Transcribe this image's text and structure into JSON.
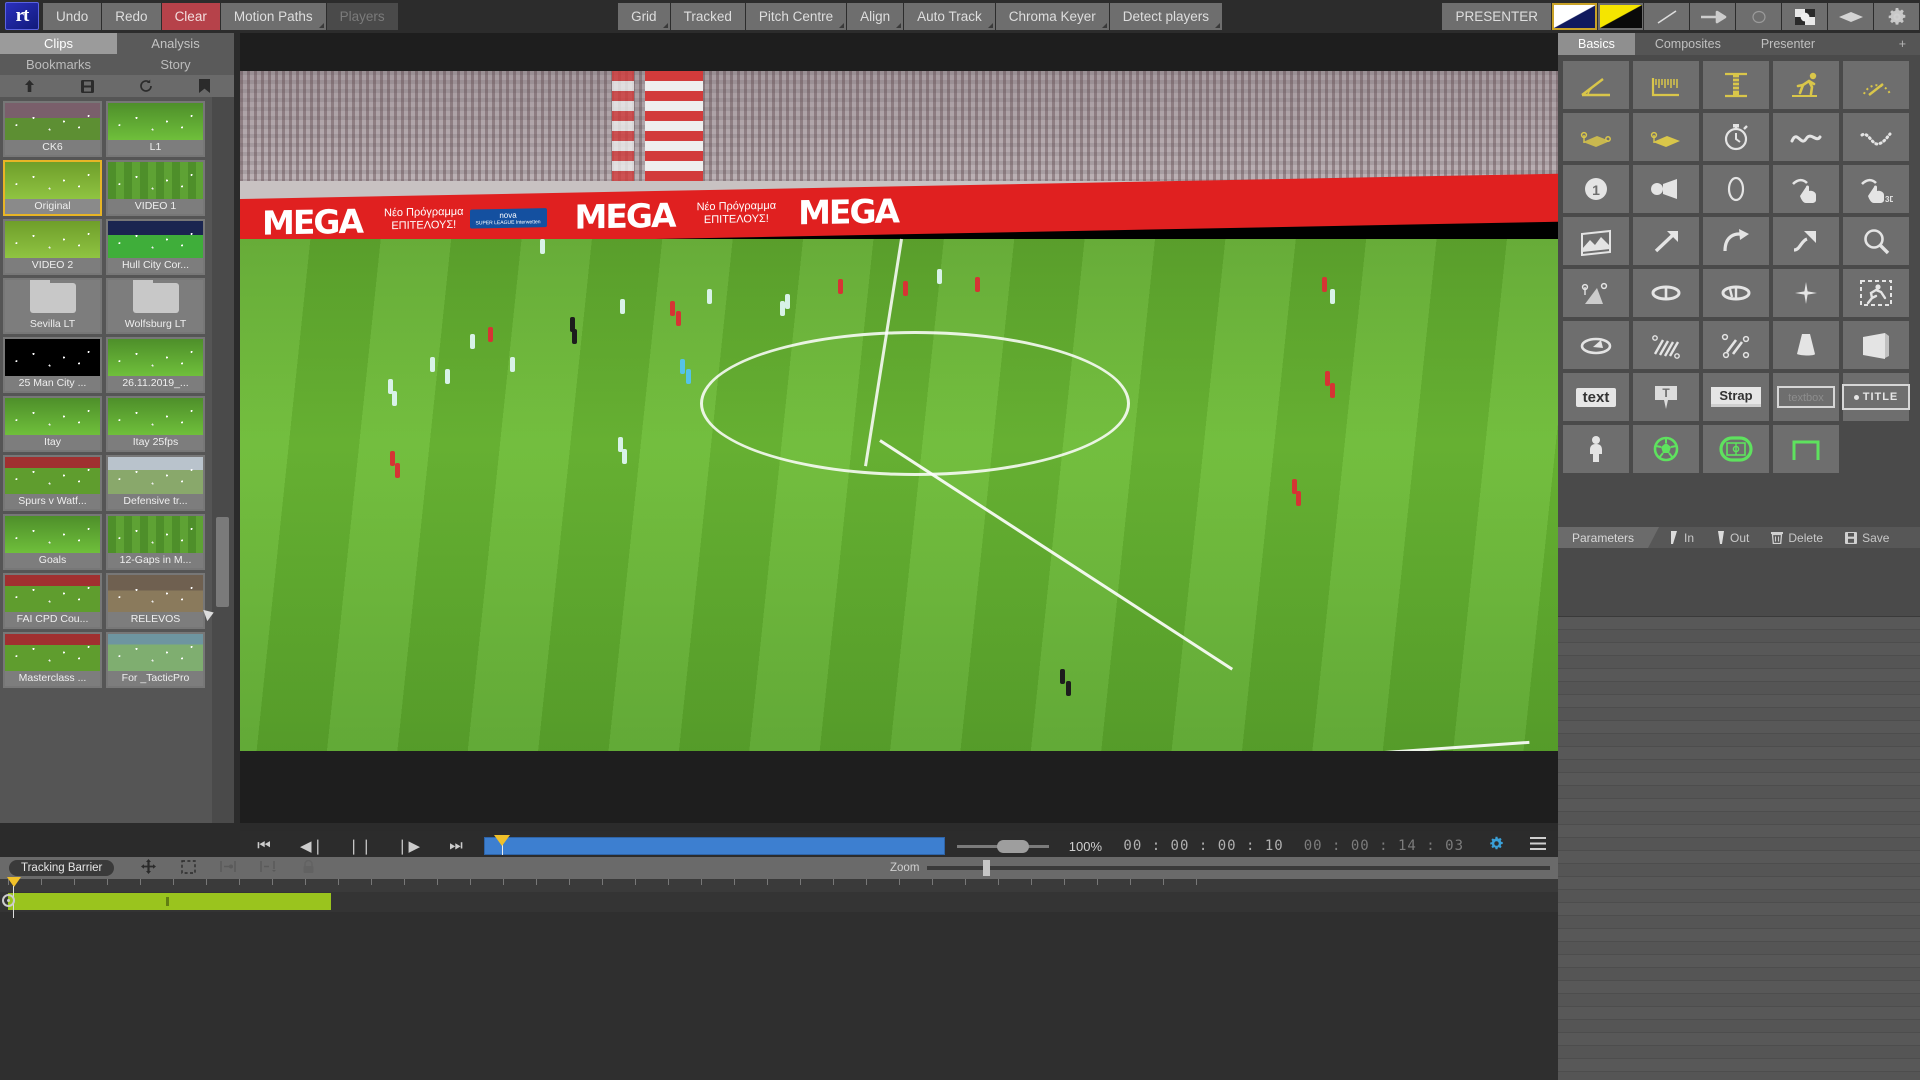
{
  "app": {
    "logo_text": "rt"
  },
  "toolbar_left": [
    {
      "label": "Undo",
      "state": "normal",
      "caret": false
    },
    {
      "label": "Redo",
      "state": "normal",
      "caret": false
    },
    {
      "label": "Clear",
      "state": "danger",
      "caret": false
    },
    {
      "label": "Motion Paths",
      "state": "normal",
      "caret": true
    },
    {
      "label": "Players",
      "state": "disabled",
      "caret": false
    }
  ],
  "toolbar_center": [
    {
      "label": "Grid",
      "caret": true
    },
    {
      "label": "Tracked",
      "caret": false
    },
    {
      "label": "Pitch Centre",
      "caret": true
    },
    {
      "label": "Align",
      "caret": true
    },
    {
      "label": "Auto Track",
      "caret": true
    },
    {
      "label": "Chroma Keyer",
      "caret": true
    },
    {
      "label": "Detect players",
      "caret": true
    }
  ],
  "toolbar_right": {
    "presenter_label": "PRESENTER",
    "swatches": [
      {
        "name": "white-navy-swatch",
        "selected": true,
        "colors": [
          "#ffffff",
          "#111a5e"
        ]
      },
      {
        "name": "yellow-black-swatch",
        "selected": false,
        "colors": [
          "#f5e500",
          "#0a0a0a"
        ]
      }
    ],
    "icons": [
      "line-icon",
      "arrow-icon",
      "circle-icon",
      "checker-icon",
      "diamond-icon",
      "gear-icon"
    ]
  },
  "left_panel": {
    "tabs_row1": [
      {
        "label": "Clips",
        "active": true
      },
      {
        "label": "Analysis",
        "active": false
      }
    ],
    "tabs_row2": [
      {
        "label": "Bookmarks",
        "active": false
      },
      {
        "label": "Story",
        "active": false
      }
    ],
    "tool_icons": [
      "upload-icon",
      "save-icon",
      "refresh-icon",
      "bookmark-icon"
    ],
    "clips": [
      {
        "label": "CK6",
        "thumb": "crowd",
        "selected": false,
        "type": "video"
      },
      {
        "label": "L1",
        "thumb": "pitch",
        "selected": false,
        "type": "video"
      },
      {
        "label": "Original",
        "thumb": "pitch2",
        "selected": true,
        "type": "video"
      },
      {
        "label": "VIDEO 1",
        "thumb": "stripe",
        "selected": false,
        "type": "video"
      },
      {
        "label": "VIDEO 2",
        "thumb": "pitch2",
        "selected": false,
        "type": "video"
      },
      {
        "label": "Hull City Cor...",
        "thumb": "night",
        "selected": false,
        "type": "video"
      },
      {
        "label": "Sevilla LT",
        "thumb": "folder",
        "selected": false,
        "type": "folder"
      },
      {
        "label": "Wolfsburg LT",
        "thumb": "folder",
        "selected": false,
        "type": "folder"
      },
      {
        "label": "25 Man City ...",
        "thumb": "dark",
        "selected": false,
        "type": "video"
      },
      {
        "label": "26.11.2019_...",
        "thumb": "pitch",
        "selected": false,
        "type": "video"
      },
      {
        "label": "Itay",
        "thumb": "pitch",
        "selected": false,
        "type": "video"
      },
      {
        "label": "Itay 25fps",
        "thumb": "pitch",
        "selected": false,
        "type": "video"
      },
      {
        "label": "Spurs v Watf...",
        "thumb": "red",
        "selected": false,
        "type": "video"
      },
      {
        "label": "Defensive tr...",
        "thumb": "blur",
        "selected": false,
        "type": "video"
      },
      {
        "label": "Goals",
        "thumb": "pitch",
        "selected": false,
        "type": "video"
      },
      {
        "label": "12-Gaps in M...",
        "thumb": "stripe",
        "selected": false,
        "type": "video"
      },
      {
        "label": "FAI CPD Cou...",
        "thumb": "red",
        "selected": false,
        "type": "video"
      },
      {
        "label": "RELEVOS",
        "thumb": "brown",
        "selected": false,
        "type": "video"
      },
      {
        "label": "Masterclass ...",
        "thumb": "red",
        "selected": false,
        "type": "video"
      },
      {
        "label": "For _TacticPro",
        "thumb": "teal",
        "selected": false,
        "type": "video"
      }
    ]
  },
  "video": {
    "board_primary": "MEGA",
    "board_sub_line1": "Νέο Πρόγραμμα",
    "board_sub_line2": "ΕΠΙΤΕΛΟΥΣ!",
    "board_sponsor": "nova",
    "board_sponsor_sub": "SUPER LEAGUE Interwetten",
    "board_color": "#e02020"
  },
  "transport": {
    "buttons": [
      {
        "name": "skip-to-start-button",
        "glyph": "⏮"
      },
      {
        "name": "step-back-button",
        "glyph": "◀❘"
      },
      {
        "name": "pause-button",
        "glyph": "❘❘"
      },
      {
        "name": "step-forward-button",
        "glyph": "❘▶"
      },
      {
        "name": "skip-to-end-button",
        "glyph": "⏭"
      }
    ],
    "zoom_percent": "100%",
    "timecode_current": "00 : 00 : 00 : 10",
    "timecode_total": "00 : 00 : 14 : 03",
    "settings_icon": "settings-gear-icon",
    "menu_icon": "hamburger-menu-icon"
  },
  "timeline": {
    "mode_chip": "Tracking Barrier",
    "tools": [
      "move-icon",
      "marquee-select-icon",
      "insert-keyframe-icon",
      "remove-keyframe-icon",
      "lock-icon"
    ],
    "zoom_label": "Zoom",
    "zoom_value": 9
  },
  "right_panel": {
    "tabs": [
      {
        "label": "Basics",
        "active": true
      },
      {
        "label": "Composites",
        "active": false
      },
      {
        "label": "Presenter",
        "active": false
      },
      {
        "label": "+",
        "active": false
      }
    ],
    "tools": [
      {
        "name": "angle-tool",
        "color": "gold"
      },
      {
        "name": "ruler-tool",
        "color": "gold"
      },
      {
        "name": "height-measure-tool",
        "color": "gold"
      },
      {
        "name": "runner-speed-tool",
        "color": "gold"
      },
      {
        "name": "speedometer-tool",
        "color": "gold"
      },
      {
        "name": "offside-line-tool",
        "color": "gold"
      },
      {
        "name": "offside-shadow-tool",
        "color": "gold"
      },
      {
        "name": "stopwatch-tool",
        "color": "white"
      },
      {
        "name": "freehand-curve-tool",
        "color": "white"
      },
      {
        "name": "dotted-path-tool",
        "color": "white"
      },
      {
        "name": "number-marker-tool",
        "color": "white"
      },
      {
        "name": "spotlight-cone-tool",
        "color": "white"
      },
      {
        "name": "ellipse-highlight-tool",
        "color": "white"
      },
      {
        "name": "drag-highlight-tool",
        "color": "white"
      },
      {
        "name": "drag-3d-highlight-tool",
        "color": "white"
      },
      {
        "name": "image-warp-tool",
        "color": "white"
      },
      {
        "name": "straight-arrow-tool",
        "color": "white"
      },
      {
        "name": "curved-arrow-tool",
        "color": "white"
      },
      {
        "name": "bent-arrow-tool",
        "color": "white"
      },
      {
        "name": "magnifier-tool",
        "color": "white"
      },
      {
        "name": "distance-ramp-tool",
        "color": "white"
      },
      {
        "name": "ellipse-ring-tool",
        "color": "white"
      },
      {
        "name": "ellipse-split-ring-tool",
        "color": "white"
      },
      {
        "name": "sparkle-tool",
        "color": "white"
      },
      {
        "name": "cutout-player-tool",
        "color": "white",
        "selected": true
      },
      {
        "name": "flat-ellipse-tool",
        "color": "white"
      },
      {
        "name": "hatched-zone-tool",
        "color": "white"
      },
      {
        "name": "connected-zone-tool",
        "color": "white"
      },
      {
        "name": "cone-tool",
        "color": "white"
      },
      {
        "name": "wall-panel-tool",
        "color": "white"
      },
      {
        "name": "text-tool",
        "color": "white",
        "label": "text"
      },
      {
        "name": "callout-text-tool",
        "color": "white",
        "label": "T"
      },
      {
        "name": "strap-tool",
        "color": "white",
        "label": "Strap"
      },
      {
        "name": "textbox-tool",
        "color": "white",
        "label": "textbox"
      },
      {
        "name": "title-tool",
        "color": "white",
        "label": "TITLE"
      },
      {
        "name": "player-figure-tool",
        "color": "white"
      },
      {
        "name": "ball-tool",
        "color": "green"
      },
      {
        "name": "pitch-overlay-tool",
        "color": "green",
        "selected": true
      },
      {
        "name": "goal-frame-tool",
        "color": "green"
      }
    ],
    "params_bar": {
      "title": "Parameters",
      "items": [
        {
          "label": "In",
          "icon": "mark-in-icon"
        },
        {
          "label": "Out",
          "icon": "mark-out-icon"
        },
        {
          "label": "Delete",
          "icon": "trash-icon"
        },
        {
          "label": "Save",
          "icon": "save-disk-icon"
        }
      ]
    }
  }
}
